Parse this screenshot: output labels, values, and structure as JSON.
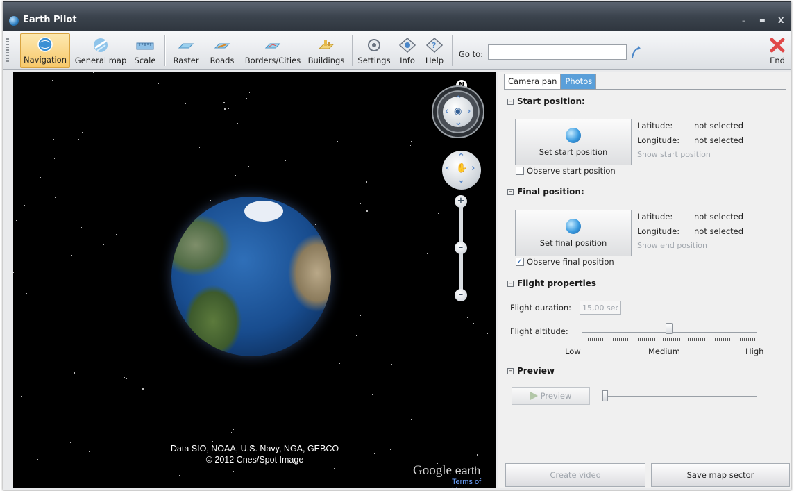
{
  "window": {
    "title": "Earth Pilot",
    "minimize": "–",
    "maximize": "▬",
    "close": "X"
  },
  "toolbar": {
    "buttons": [
      {
        "label": "Navigation",
        "icon": "navigation-globe-icon",
        "active": true
      },
      {
        "label": "General map",
        "icon": "general-map-icon"
      },
      {
        "label": "Scale",
        "icon": "ruler-icon"
      },
      {
        "label": "Raster",
        "icon": "raster-icon"
      },
      {
        "label": "Roads",
        "icon": "roads-icon"
      },
      {
        "label": "Borders/Cities",
        "icon": "borders-icon"
      },
      {
        "label": "Buildings",
        "icon": "buildings-icon"
      },
      {
        "label": "Settings",
        "icon": "settings-icon"
      },
      {
        "label": "Info",
        "icon": "info-icon"
      },
      {
        "label": "Help",
        "icon": "help-icon"
      }
    ],
    "goto_label": "Go to:",
    "goto_value": "",
    "end_label": "End"
  },
  "map": {
    "credit_line1": "Data SIO, NOAA, U.S. Navy, NGA, GEBCO",
    "credit_line2": "© 2012 Cnes/Spot Image",
    "google": "Google",
    "earth": "earth",
    "terms": "Terms of Use",
    "north": "N",
    "zoom_in": "+",
    "zoom_out": "–"
  },
  "panel": {
    "tabs": [
      "Camera pan",
      "Photos"
    ],
    "start": {
      "header": "Start position:",
      "button": "Set start position",
      "lat_label": "Latitude:",
      "lat_value": "not selected",
      "lon_label": "Longitude:",
      "lon_value": "not selected",
      "show_link": "Show start position",
      "observe": "Observe start position",
      "observe_checked": false
    },
    "final": {
      "header": "Final position:",
      "button": "Set final position",
      "lat_label": "Latitude:",
      "lat_value": "not selected",
      "lon_label": "Longitude:",
      "lon_value": "not selected",
      "show_link": "Show end position",
      "observe": "Observe final position",
      "observe_checked": true
    },
    "flight": {
      "header": "Flight properties",
      "duration_label": "Flight duration:",
      "duration_value": "15,00 sec",
      "altitude_label": "Flight altitude:",
      "low": "Low",
      "medium": "Medium",
      "high": "High",
      "altitude_level": 0.5
    },
    "preview": {
      "header": "Preview",
      "button": "Preview"
    },
    "create_video": "Create video",
    "save_sector": "Save map sector"
  }
}
